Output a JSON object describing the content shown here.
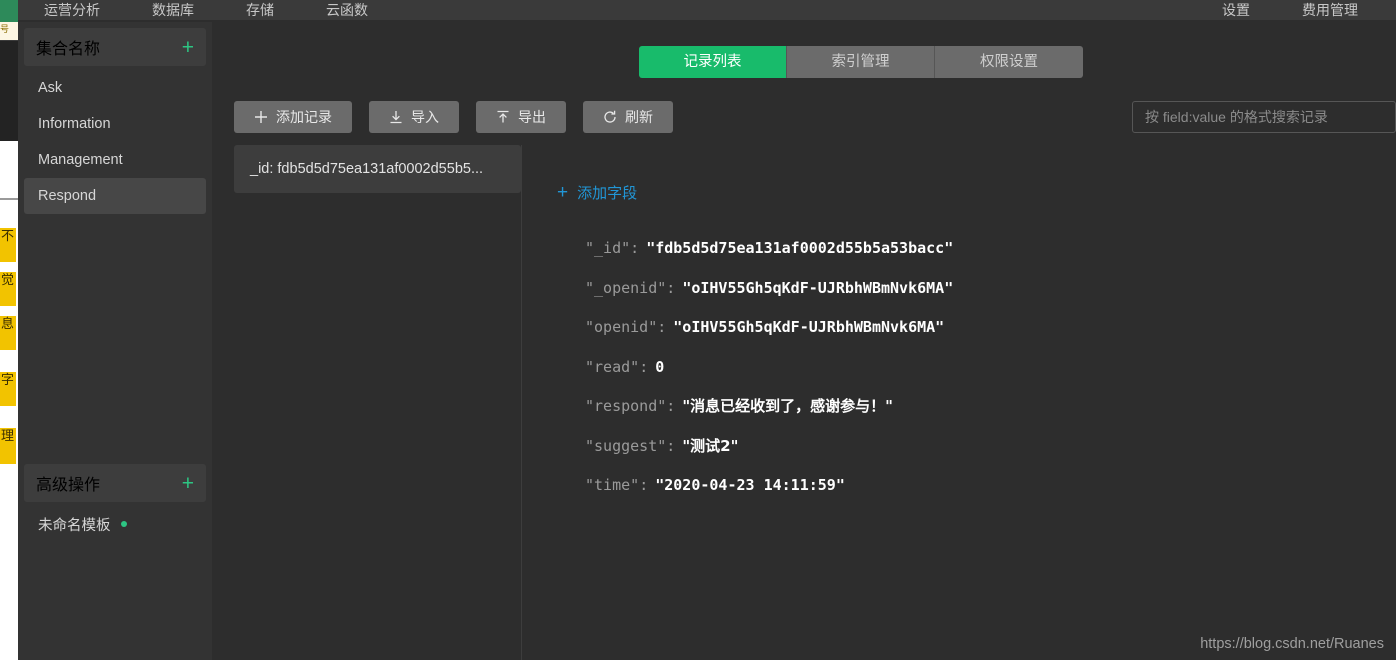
{
  "topnav": {
    "left_items": [
      {
        "label": "运营分析",
        "name": "nav-operations-analysis"
      },
      {
        "label": "数据库",
        "name": "nav-database"
      },
      {
        "label": "存储",
        "name": "nav-storage"
      },
      {
        "label": "云函数",
        "name": "nav-cloud-functions"
      }
    ],
    "right_items": [
      {
        "label": "设置",
        "name": "nav-settings"
      },
      {
        "label": "费用管理",
        "name": "nav-billing"
      }
    ]
  },
  "sidebar": {
    "collections": {
      "title": "集合名称",
      "add_icon": "plus-icon",
      "items": [
        {
          "label": "Ask",
          "selected": false
        },
        {
          "label": "Information",
          "selected": false
        },
        {
          "label": "Management",
          "selected": false
        },
        {
          "label": "Respond",
          "selected": true
        }
      ]
    },
    "advanced": {
      "title": "高级操作",
      "add_icon": "plus-icon",
      "items": [
        {
          "label": "未命名模板",
          "dot": true
        }
      ]
    }
  },
  "main": {
    "tabs": [
      {
        "label": "记录列表",
        "active": true
      },
      {
        "label": "索引管理",
        "active": false
      },
      {
        "label": "权限设置",
        "active": false
      }
    ],
    "toolbar": [
      {
        "label": "添加记录",
        "icon": "plus-icon",
        "name": "add-record-button"
      },
      {
        "label": "导入",
        "icon": "import-down-arrow-icon",
        "name": "import-button"
      },
      {
        "label": "导出",
        "icon": "export-up-arrow-icon",
        "name": "export-button"
      },
      {
        "label": "刷新",
        "icon": "refresh-icon",
        "name": "refresh-button"
      }
    ],
    "search": {
      "placeholder": "按 field:value 的格式搜索记录",
      "value": ""
    },
    "record_list": [
      {
        "label": "_id: fdb5d5d75ea131af0002d55b5...",
        "selected": true
      }
    ],
    "add_field_link": "添加字段",
    "document": [
      {
        "key": "\"_id\"",
        "colon": ":",
        "value": "\"fdb5d5d75ea131af0002d55b5a53bacc\"",
        "cjk": false
      },
      {
        "key": "\"_openid\"",
        "colon": ":",
        "value": "\"oIHV55Gh5qKdF-UJRbhWBmNvk6MA\"",
        "cjk": false
      },
      {
        "key": "\"openid\"",
        "colon": ":",
        "value": "\"oIHV55Gh5qKdF-UJRbhWBmNvk6MA\"",
        "cjk": false
      },
      {
        "key": "\"read\"",
        "colon": ":",
        "value": "0",
        "cjk": false
      },
      {
        "key": "\"respond\"",
        "colon": ":",
        "value": "\"消息已经收到了，感谢参与！\"",
        "cjk": true
      },
      {
        "key": "\"suggest\"",
        "colon": ":",
        "value": "\"测试2\"",
        "cjk": true
      },
      {
        "key": "\"time\"",
        "colon": ":",
        "value": "\"2020-04-23 14:11:59\"",
        "cjk": false
      }
    ]
  },
  "watermark": "https://blog.csdn.net/Ruanes",
  "colors": {
    "accent_green": "#18bb6b",
    "plus_green": "#2dc583",
    "link_blue": "#2196d6",
    "app_bg": "#2d2d2d",
    "sidebar_bg": "#333333",
    "topnav_bg": "#3a3a3a",
    "button_bg": "#6b6b6b",
    "highlight_yellow": "#f2c300"
  }
}
